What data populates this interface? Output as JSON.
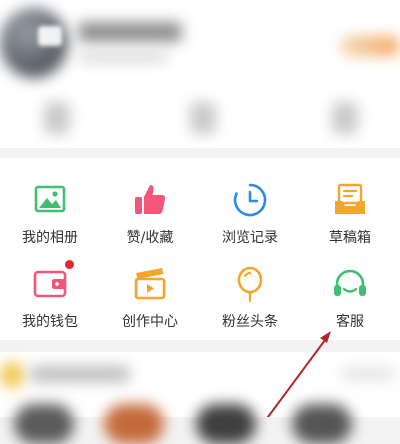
{
  "menu": {
    "items": [
      {
        "label": "我的相册",
        "icon": "photo-album-icon",
        "color": "#3fbf6f"
      },
      {
        "label": "赞/收藏",
        "icon": "thumbs-up-icon",
        "color": "#f2577a"
      },
      {
        "label": "浏览记录",
        "icon": "clock-history-icon",
        "color": "#2b8be8"
      },
      {
        "label": "草稿箱",
        "icon": "draft-box-icon",
        "color": "#f4a52d"
      },
      {
        "label": "我的钱包",
        "icon": "wallet-icon",
        "color": "#f2577a",
        "has_notification_dot": true
      },
      {
        "label": "创作中心",
        "icon": "clapperboard-icon",
        "color": "#f4a52d"
      },
      {
        "label": "粉丝头条",
        "icon": "balloon-icon",
        "color": "#f4a52d"
      },
      {
        "label": "客服",
        "icon": "headset-icon",
        "color": "#3fbf6f"
      }
    ]
  },
  "colors": {
    "notification_dot": "#e8252f",
    "annotation_arrow": "#b3262e",
    "label_text": "#333333"
  }
}
